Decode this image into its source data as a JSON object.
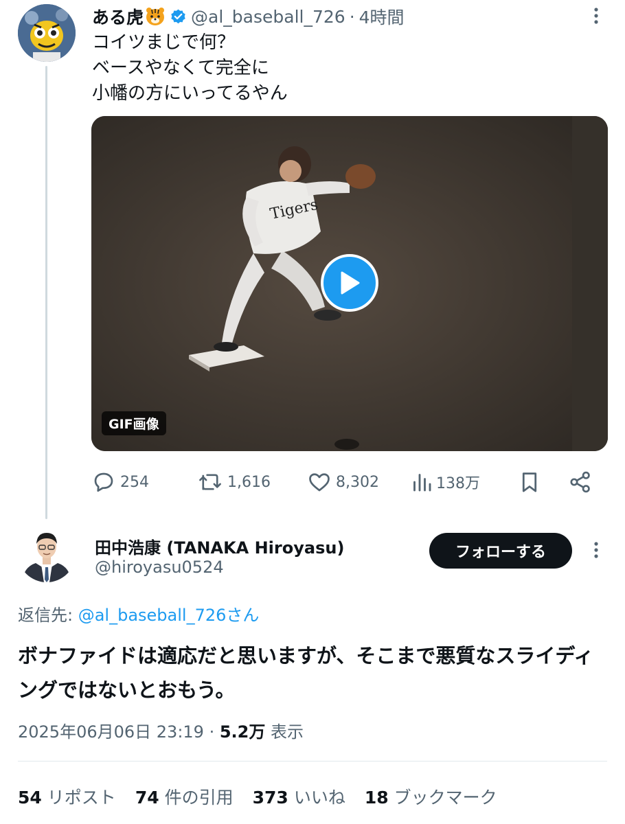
{
  "tweet1": {
    "name": "ある虎",
    "handle": "@al_baseball_726",
    "separator": "·",
    "time": "4時間",
    "text": "コイツまじで何？\nベースやなくて完全に\n小幡の方にいってるやん",
    "media": {
      "badge": "GIF画像",
      "icon": "play-icon"
    },
    "actions": {
      "replies": "254",
      "reposts": "1,616",
      "likes": "8,302",
      "views": "138万"
    }
  },
  "tweet2": {
    "name": "田中浩康 (TANAKA Hiroyasu)",
    "handle": "@hiroyasu0524",
    "follow_label": "フォローする",
    "reply_prefix": "返信先: ",
    "reply_mention": "@al_baseball_726",
    "reply_suffix": "さん",
    "text": "ボナファイドは適応だと思いますが、そこまで悪質なスライディングではないとおもう。",
    "date": "2025年06月06日 23:19",
    "meta_sep": " · ",
    "views": "5.2万",
    "views_label": " 表示",
    "stats": [
      {
        "count": "54",
        "label": "リポスト"
      },
      {
        "count": "74",
        "label": "件の引用"
      },
      {
        "count": "373",
        "label": "いいね"
      },
      {
        "count": "18",
        "label": "ブックマーク"
      }
    ]
  },
  "colors": {
    "accent": "#1d9bf0",
    "text": "#0f1419",
    "muted": "#536471"
  }
}
